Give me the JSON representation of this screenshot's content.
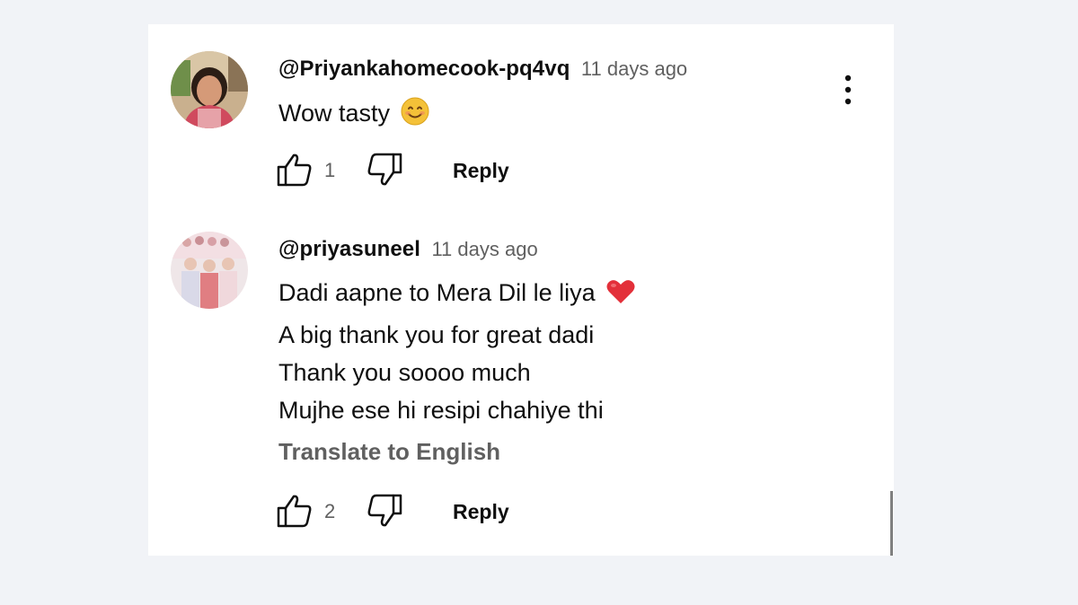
{
  "comments": [
    {
      "author": "@Priyankahomecook-pq4vq",
      "time": "11 days ago",
      "lines": [
        "Wow tasty"
      ],
      "emoji": "smiling-face-emoji",
      "likes": "1",
      "reply_label": "Reply"
    },
    {
      "author": "@priyasuneel",
      "time": "11 days ago",
      "lines": [
        "Dadi aapne to Mera Dil le liya",
        "A big thank you for great dadi",
        "Thank you soooo much",
        "Mujhe ese hi resipi chahiye thi"
      ],
      "emoji": "red-heart-emoji",
      "translate_label": "Translate to English",
      "likes": "2",
      "reply_label": "Reply"
    }
  ],
  "icons": {
    "like": "thumbs-up-icon",
    "dislike": "thumbs-down-icon",
    "menu": "more-vertical-icon"
  },
  "colors": {
    "page_background": "#f1f3f7",
    "panel_background": "#ffffff",
    "primary_text": "#0f0f0f",
    "secondary_text": "#606060",
    "heart": "#e3303a",
    "smile": "#f4c138"
  }
}
